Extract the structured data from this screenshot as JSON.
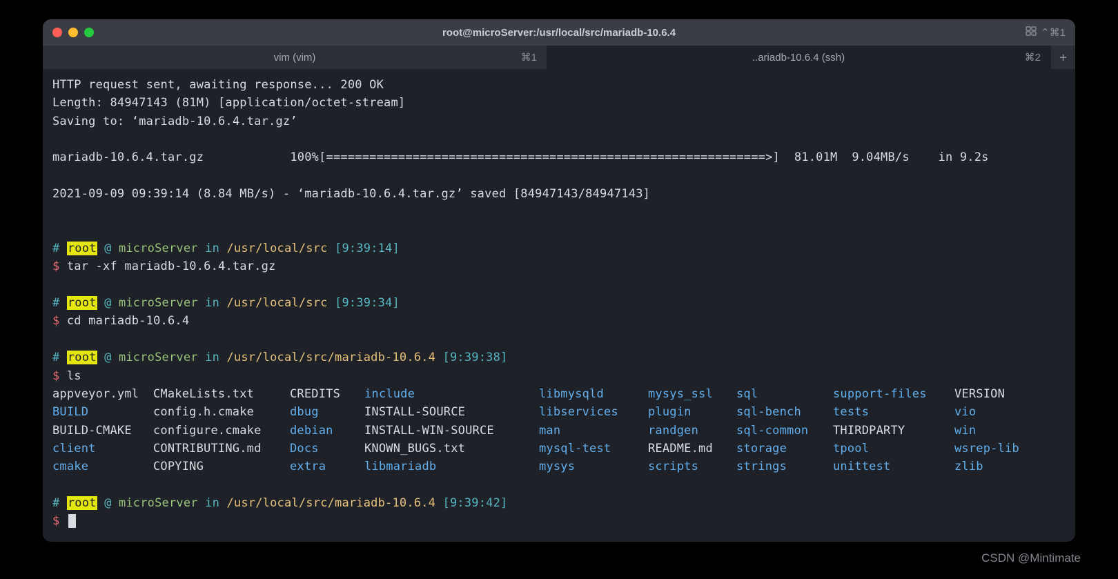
{
  "window": {
    "title": "root@microServer:/usr/local/src/mariadb-10.6.4",
    "broadcast_shortcut": "⌃⌘1"
  },
  "tabs": [
    {
      "label": "vim (vim)",
      "shortcut": "⌘1",
      "active": false
    },
    {
      "label": "..ariadb-10.6.4 (ssh)",
      "shortcut": "⌘2",
      "active": true
    }
  ],
  "tab_add": "+",
  "wget": {
    "line1": "HTTP request sent, awaiting response... 200 OK",
    "line2": "Length: 84947143 (81M) [application/octet-stream]",
    "line3": "Saving to: ‘mariadb-10.6.4.tar.gz’",
    "prog_name": "mariadb-10.6.4.tar.gz",
    "prog_pct": "100%",
    "prog_bar": "[=============================================================>]",
    "prog_size": "81.01M",
    "prog_speed": "9.04MB/s",
    "prog_in": "in 9.2s",
    "done": "2021-09-09 09:39:14 (8.84 MB/s) - ‘mariadb-10.6.4.tar.gz’ saved [84947143/84947143]"
  },
  "prompts": [
    {
      "hash": "#",
      "user": "root",
      "at": "@",
      "host": "microServer",
      "in": "in",
      "path": "/usr/local/src",
      "time": "[9:39:14]",
      "dollar": "$",
      "cmd": "tar -xf mariadb-10.6.4.tar.gz"
    },
    {
      "hash": "#",
      "user": "root",
      "at": "@",
      "host": "microServer",
      "in": "in",
      "path": "/usr/local/src",
      "time": "[9:39:34]",
      "dollar": "$",
      "cmd": "cd mariadb-10.6.4"
    },
    {
      "hash": "#",
      "user": "root",
      "at": "@",
      "host": "microServer",
      "in": "in",
      "path": "/usr/local/src/mariadb-10.6.4",
      "time": "[9:39:38]",
      "dollar": "$",
      "cmd": "ls"
    },
    {
      "hash": "#",
      "user": "root",
      "at": "@",
      "host": "microServer",
      "in": "in",
      "path": "/usr/local/src/mariadb-10.6.4",
      "time": "[9:39:42]",
      "dollar": "$",
      "cmd": ""
    }
  ],
  "ls": [
    {
      "t": "appveyor.yml",
      "c": "w"
    },
    {
      "t": "CMakeLists.txt",
      "c": "w"
    },
    {
      "t": "CREDITS",
      "c": "w"
    },
    {
      "t": "include",
      "c": "b"
    },
    {
      "t": "libmysqld",
      "c": "b"
    },
    {
      "t": "mysys_ssl",
      "c": "b"
    },
    {
      "t": "sql",
      "c": "b"
    },
    {
      "t": "support-files",
      "c": "b"
    },
    {
      "t": "VERSION",
      "c": "w"
    },
    {
      "t": "BUILD",
      "c": "b"
    },
    {
      "t": "config.h.cmake",
      "c": "w"
    },
    {
      "t": "dbug",
      "c": "b"
    },
    {
      "t": "INSTALL-SOURCE",
      "c": "w"
    },
    {
      "t": "libservices",
      "c": "b"
    },
    {
      "t": "plugin",
      "c": "b"
    },
    {
      "t": "sql-bench",
      "c": "b"
    },
    {
      "t": "tests",
      "c": "b"
    },
    {
      "t": "vio",
      "c": "b"
    },
    {
      "t": "BUILD-CMAKE",
      "c": "w"
    },
    {
      "t": "configure.cmake",
      "c": "w"
    },
    {
      "t": "debian",
      "c": "b"
    },
    {
      "t": "INSTALL-WIN-SOURCE",
      "c": "w"
    },
    {
      "t": "man",
      "c": "b"
    },
    {
      "t": "randgen",
      "c": "b"
    },
    {
      "t": "sql-common",
      "c": "b"
    },
    {
      "t": "THIRDPARTY",
      "c": "w"
    },
    {
      "t": "win",
      "c": "b"
    },
    {
      "t": "client",
      "c": "b"
    },
    {
      "t": "CONTRIBUTING.md",
      "c": "w"
    },
    {
      "t": "Docs",
      "c": "b"
    },
    {
      "t": "KNOWN_BUGS.txt",
      "c": "w"
    },
    {
      "t": "mysql-test",
      "c": "b"
    },
    {
      "t": "README.md",
      "c": "w"
    },
    {
      "t": "storage",
      "c": "b"
    },
    {
      "t": "tpool",
      "c": "b"
    },
    {
      "t": "wsrep-lib",
      "c": "b"
    },
    {
      "t": "cmake",
      "c": "b"
    },
    {
      "t": "COPYING",
      "c": "w"
    },
    {
      "t": "extra",
      "c": "b"
    },
    {
      "t": "libmariadb",
      "c": "b"
    },
    {
      "t": "mysys",
      "c": "b"
    },
    {
      "t": "scripts",
      "c": "b"
    },
    {
      "t": "strings",
      "c": "b"
    },
    {
      "t": "unittest",
      "c": "b"
    },
    {
      "t": "zlib",
      "c": "b"
    }
  ],
  "watermark": "CSDN @Mintimate"
}
